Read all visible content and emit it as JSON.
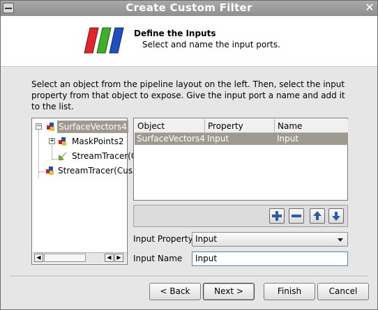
{
  "window": {
    "title": "Create Custom Filter"
  },
  "header": {
    "title": "Define the Inputs",
    "subtitle": "Select and name the input ports."
  },
  "description": "Select an object from the pipeline layout on the left. Then, select the input property from that object to expose. Give the input port a name and add it to the list.",
  "pipeline_tree": {
    "items": [
      {
        "label": "SurfaceVectors4",
        "selected": true,
        "expander": "−"
      },
      {
        "label": "MaskPoints2",
        "selected": false,
        "expander": "+"
      },
      {
        "label": "StreamTracer(C",
        "selected": false,
        "expander": ""
      },
      {
        "label": "StreamTracer(Cus",
        "selected": false,
        "expander": ""
      }
    ]
  },
  "inputs_table": {
    "columns": [
      "Object",
      "Property",
      "Name"
    ],
    "rows": [
      {
        "object": "SurfaceVectors4",
        "property": "Input",
        "name": "Input",
        "selected": true
      }
    ]
  },
  "table_buttons": {
    "add": "add-icon",
    "remove": "remove-icon",
    "move_up": "up-arrow-icon",
    "move_down": "down-arrow-icon"
  },
  "form": {
    "input_property_label": "Input Property",
    "input_property_value": "Input",
    "input_name_label": "Input Name",
    "input_name_value": "Input"
  },
  "footer": {
    "back": "< Back",
    "next": "Next >",
    "finish": "Finish",
    "cancel": "Cancel"
  },
  "colors": {
    "selection": "#9e9a91",
    "titlebar": "#9a9a9a",
    "icon_button_blue": "#2b5ea8"
  }
}
